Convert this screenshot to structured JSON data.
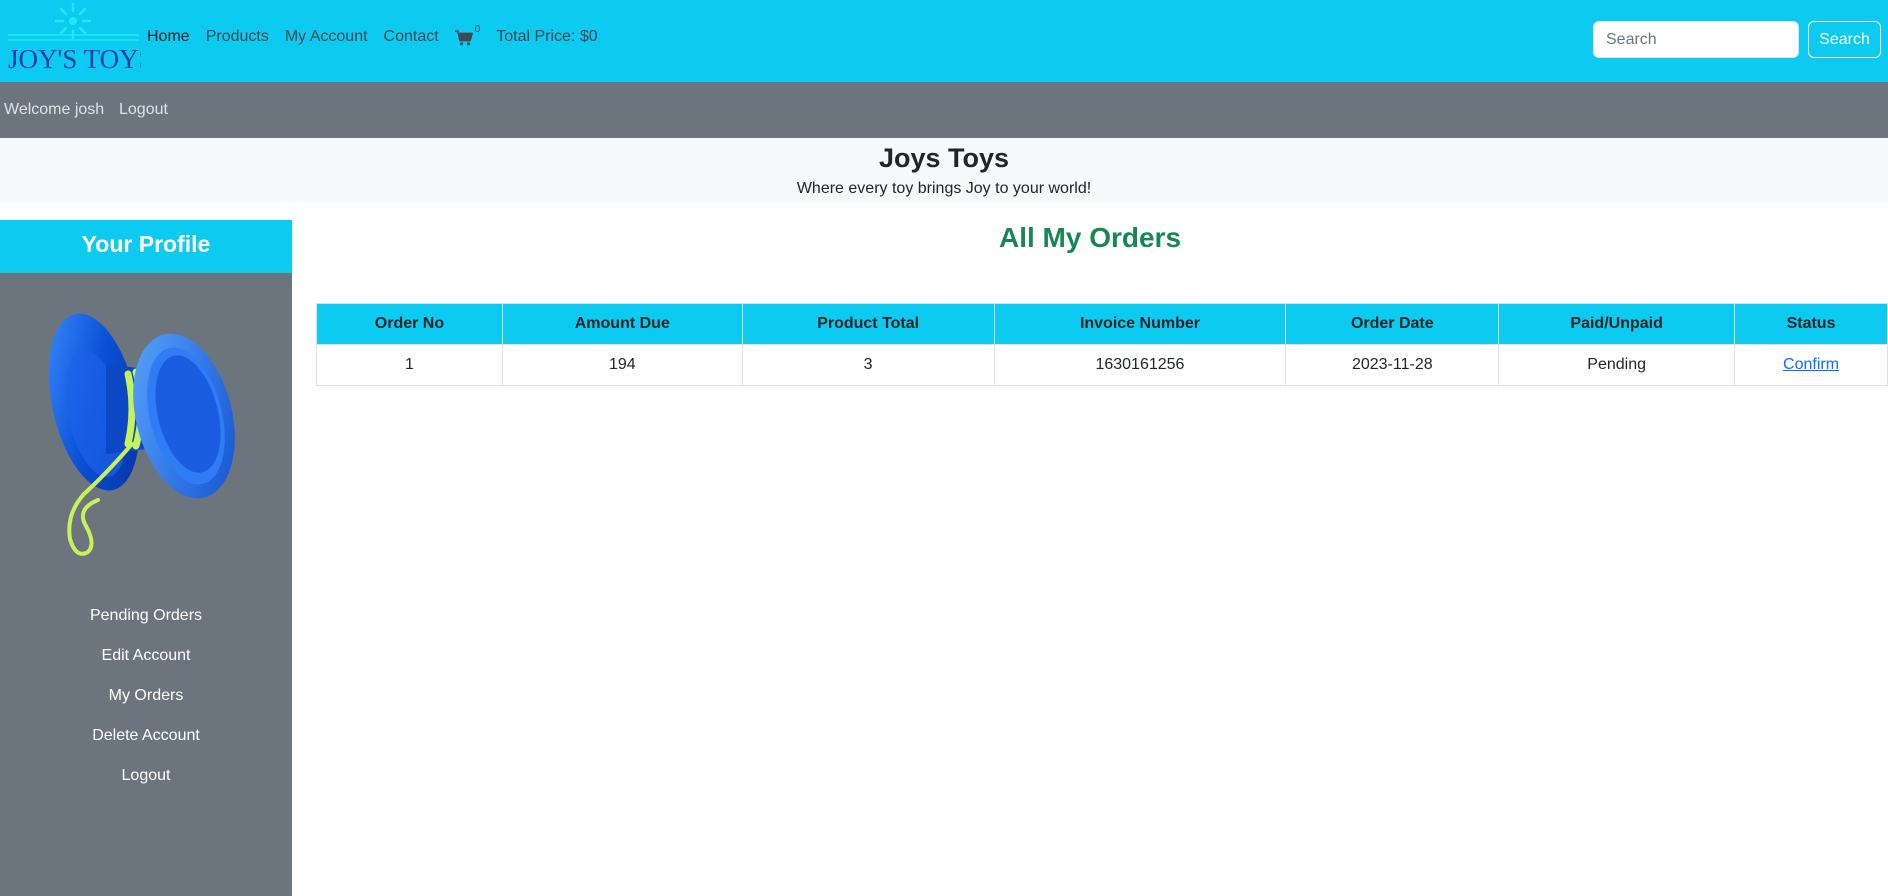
{
  "brand": {
    "logo_text": "JOY'S TOYS"
  },
  "nav": {
    "links": [
      "Home",
      "Products",
      "My Account",
      "Contact"
    ],
    "cart_count": "0",
    "total_price": "Total Price: $0",
    "search_placeholder": "Search",
    "search_button": "Search"
  },
  "subbar": {
    "welcome": "Welcome josh",
    "logout": "Logout"
  },
  "hero": {
    "title": "Joys Toys",
    "subtitle": "Where every toy brings Joy to your world!"
  },
  "sidebar": {
    "heading": "Your Profile",
    "items": [
      "Pending Orders",
      "Edit Account",
      "My Orders",
      "Delete Account",
      "Logout"
    ]
  },
  "main": {
    "title": "All My Orders",
    "table": {
      "columns": [
        "Order No",
        "Amount Due",
        "Product Total",
        "Invoice Number",
        "Order Date",
        "Paid/Unpaid",
        "Status"
      ],
      "rows": [
        [
          "1",
          "194",
          "3",
          "1630161256",
          "2023-11-28",
          "Pending",
          "Confirm"
        ]
      ]
    }
  },
  "colors": {
    "navbar": "#0dcaf0",
    "subbar": "#6c757d",
    "sidebar": "#6c757d",
    "title_green": "#198754",
    "link_blue": "#0d6efd"
  }
}
